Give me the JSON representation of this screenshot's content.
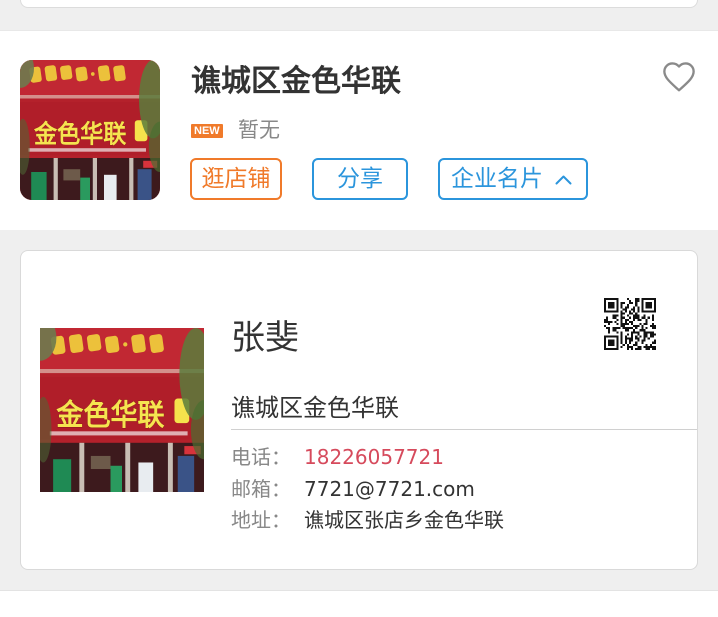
{
  "store": {
    "name": "谯城区金色华联",
    "badge": "NEW",
    "status": "暂无",
    "buttons": {
      "visit": "逛店铺",
      "share": "分享",
      "card": "企业名片"
    }
  },
  "business_card": {
    "name": "张斐",
    "company": "谯城区金色华联",
    "contacts": [
      {
        "label": "电话：",
        "value": "18226057721"
      },
      {
        "label": "邮箱：",
        "value": "7721@7721.com"
      },
      {
        "label": "地址：",
        "value": "谯城区张店乡金色华联"
      }
    ]
  },
  "images": {
    "shop_sign": "金色华联"
  },
  "icons": {
    "favorite": "heart-outline-icon",
    "card_toggle": "chevron-up-icon",
    "qr": "qr-code-icon"
  },
  "colors": {
    "page_background": "#efefef",
    "accent_orange": "#f07a2a",
    "accent_blue": "#2b95dc",
    "phone_red": "#d64a5c",
    "text_primary": "#333333",
    "text_secondary": "#888888"
  }
}
